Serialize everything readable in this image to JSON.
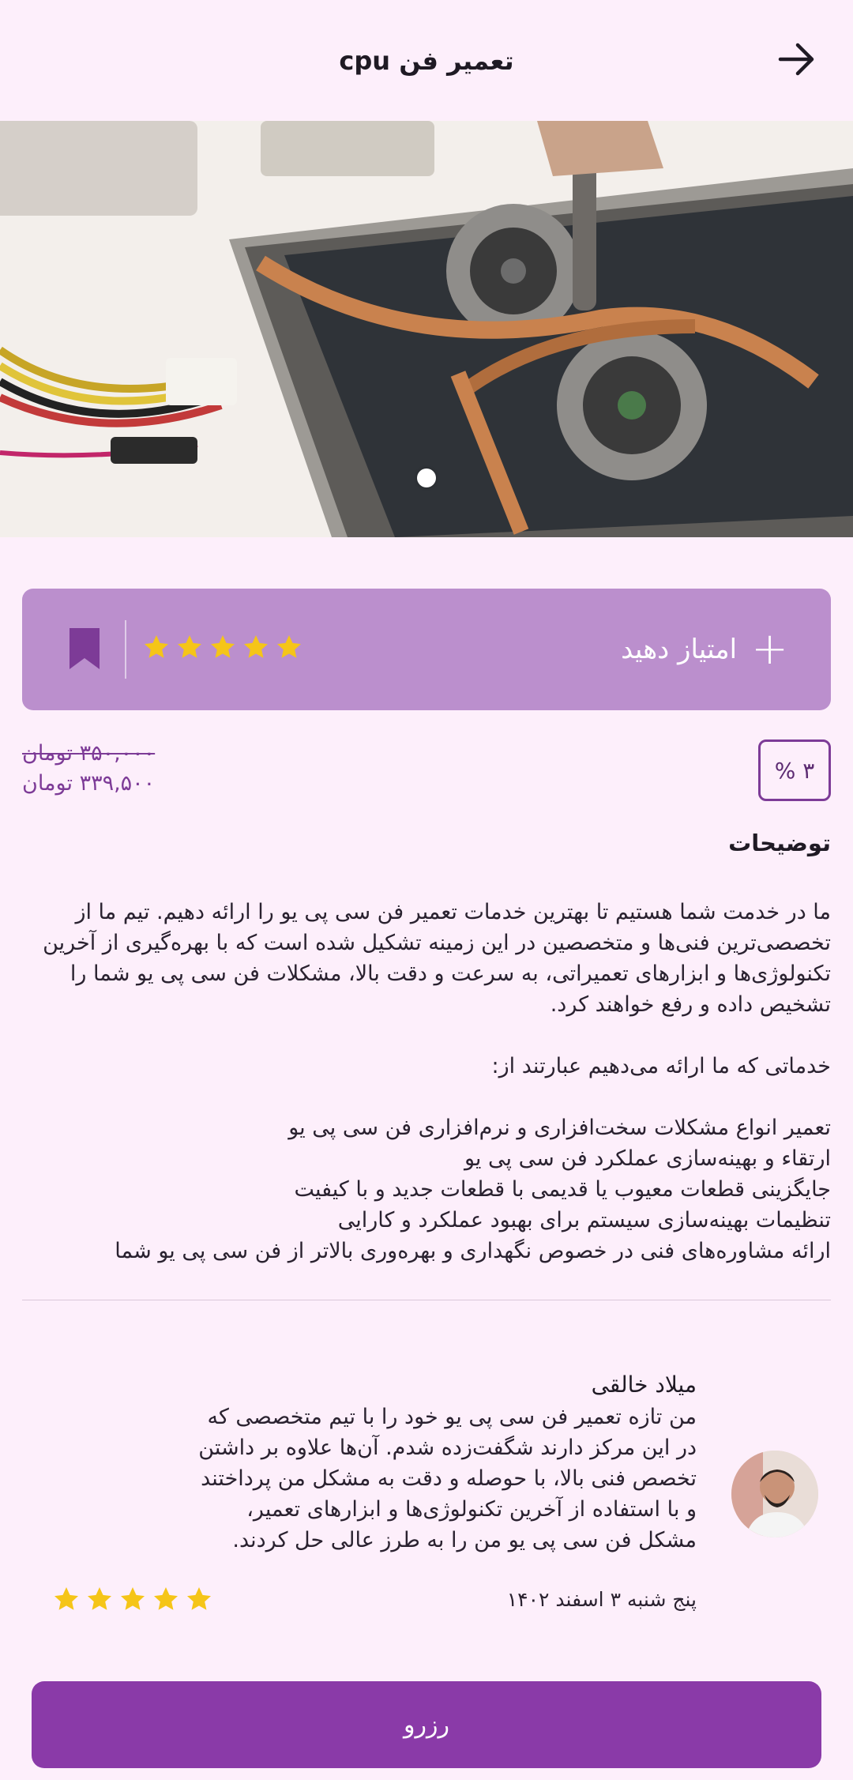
{
  "header": {
    "title": "تعمیر فن cpu"
  },
  "hero": {
    "image_subject": "laptop cpu fan repair photo",
    "slide_indicator_count": 1
  },
  "rating_card": {
    "action_label": "امتیاز دهید",
    "stars": 5,
    "background_color": "#bb8fcd",
    "star_color": "#f5c518",
    "bookmark_color": "#7d3b97"
  },
  "price": {
    "discount": "۳ %",
    "original": "۳۵۰,۰۰۰ تومان",
    "final": "۳۳۹,۵۰۰ تومان"
  },
  "description": {
    "heading": "توضیحات",
    "paragraph1": "ما در خدمت شما هستیم تا بهترین خدمات تعمیر فن سی پی یو را ارائه دهیم. تیم ما از تخصصی‌ترین فنی‌ها و متخصصین در این زمینه تشکیل شده است که با بهره‌گیری از آخرین تکنولوژی‌ها و ابزارهای تعمیراتی، به سرعت و دقت بالا، مشکلات فن سی پی یو شما را تشخیص داده و رفع خواهند کرد.",
    "paragraph2": "خدماتی که ما ارائه می‌دهیم عبارتند از:",
    "services": [
      "تعمیر انواع مشکلات سخت‌افزاری و نرم‌افزاری فن سی پی یو",
      "ارتقاء و بهینه‌سازی عملکرد فن سی پی یو",
      "جایگزینی قطعات معیوب یا قدیمی با قطعات جدید و با کیفیت",
      "تنظیمات بهینه‌سازی سیستم برای بهبود عملکرد و کارایی",
      "ارائه مشاوره‌های فنی در خصوص نگهداری و بهره‌وری بالاتر از فن سی پی یو شما"
    ]
  },
  "review": {
    "name": "میلاد خالقی",
    "text": "من تازه تعمیر فن سی پی یو خود را با تیم متخصصی که در این مرکز دارند شگفت‌زده شدم. آن‌ها علاوه بر داشتن تخصص فنی بالا، با حوصله و دقت به مشکل من پرداختند و با استفاده از آخرین تکنولوژی‌ها و ابزارهای تعمیر، مشکل فن سی پی یو من را به طرز عالی حل کردند.",
    "date": "پنج شنبه ۳ اسفند ۱۴۰۲",
    "stars": 5
  },
  "reserve_button": {
    "label": "رزرو",
    "color": "#8a3aa8"
  }
}
